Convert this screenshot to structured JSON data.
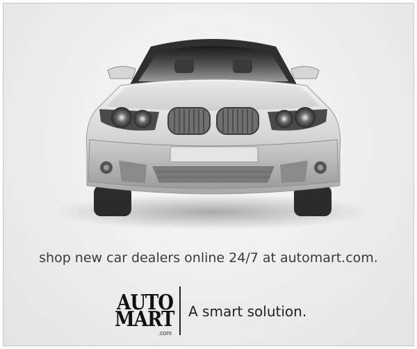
{
  "ad": {
    "tagline": "shop new car dealers online 24/7 at automart.com.",
    "logo": {
      "line1": "AUTO",
      "line2": "MART",
      "suffix": ".com"
    },
    "slogan": "A smart solution.",
    "image": "front-view-of-silver-car"
  },
  "colors": {
    "background": "#ececec",
    "text": "#3a3a3a",
    "logo": "#111111"
  }
}
